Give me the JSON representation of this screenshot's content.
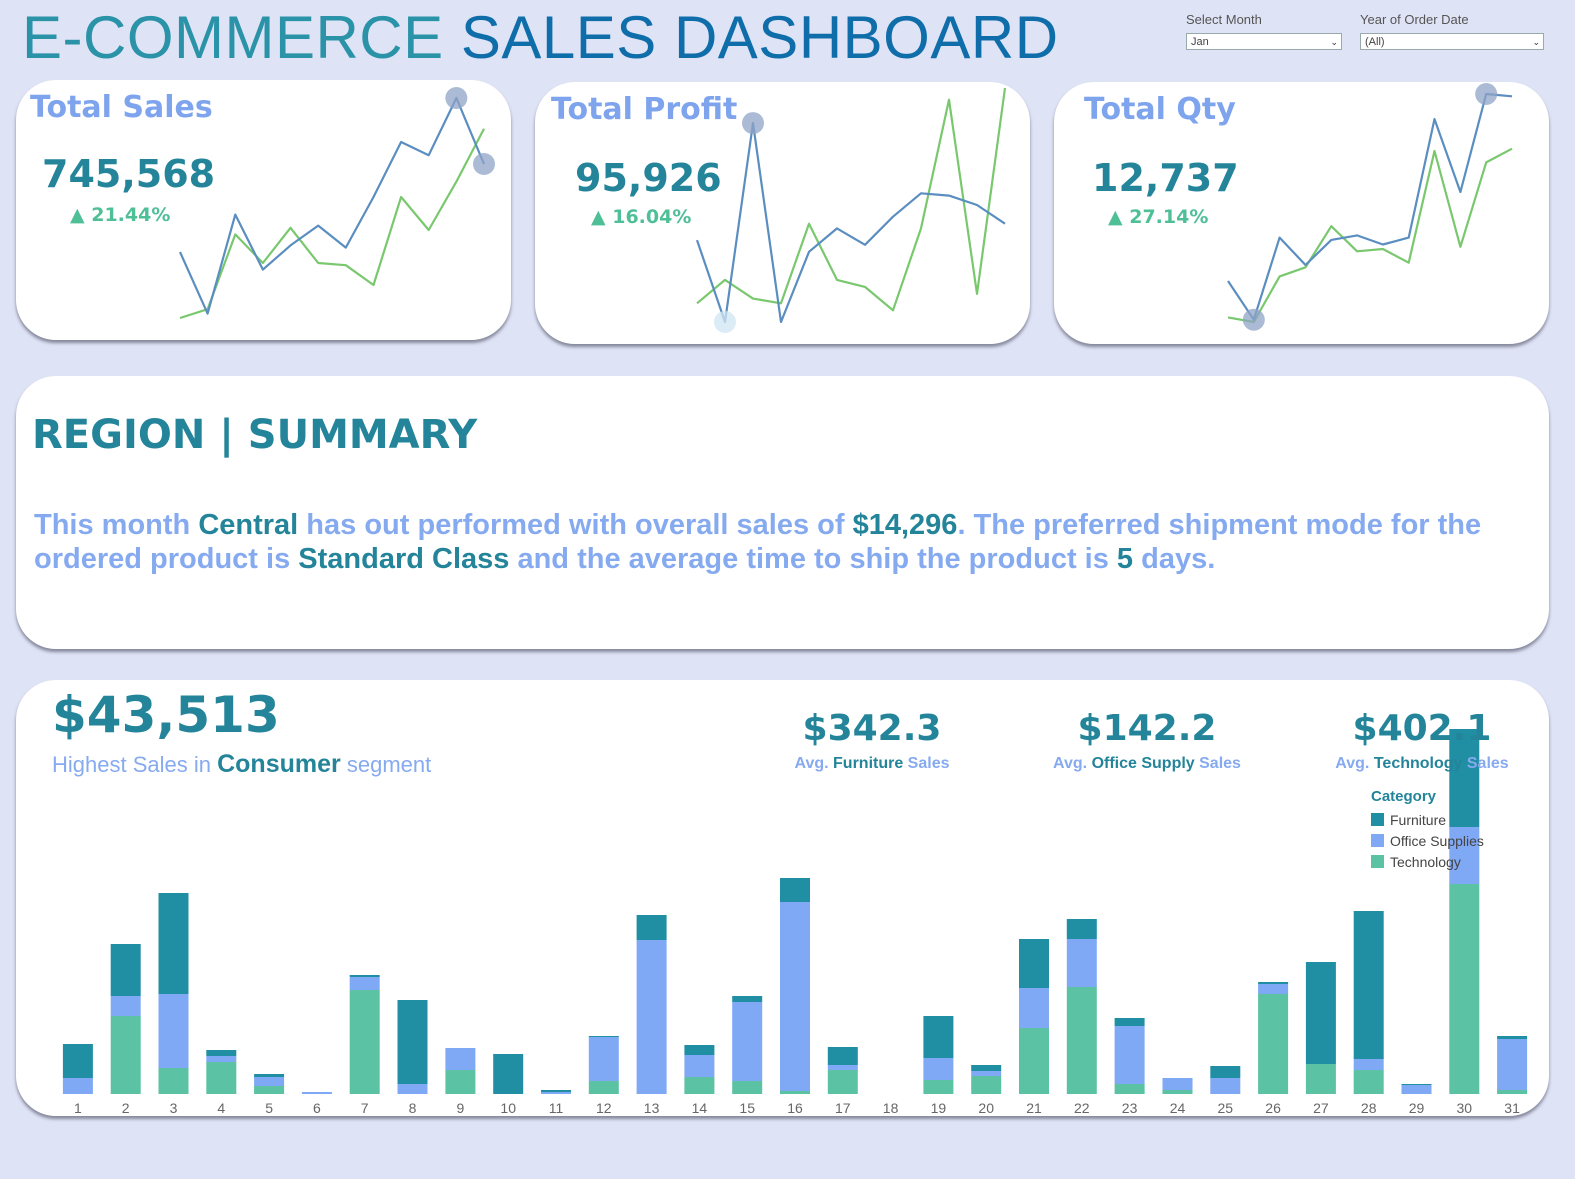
{
  "header": {
    "title_part1": "E-COMMERCE",
    "title_part2": "SALES DASHBOARD"
  },
  "filters": {
    "month": {
      "label": "Select Month",
      "value": "Jan"
    },
    "year": {
      "label": "Year of Order Date",
      "value": "(All)"
    }
  },
  "kpis": [
    {
      "title": "Total Sales",
      "value": "745,568",
      "change": "▲ 21.44%",
      "current": [
        0.3,
        0.02,
        0.47,
        0.22,
        0.33,
        0.42,
        0.32,
        0.55,
        0.8,
        0.74,
        1.0,
        0.7
      ],
      "previous": [
        0.0,
        0.04,
        0.38,
        0.25,
        0.41,
        0.25,
        0.24,
        0.15,
        0.55,
        0.4,
        0.62,
        0.86
      ]
    },
    {
      "title": "Total Profit",
      "value": "95,926",
      "change": "▲ 16.04%",
      "current": [
        0.35,
        0.0,
        0.85,
        0.0,
        0.3,
        0.4,
        0.33,
        0.45,
        0.55,
        0.54,
        0.5,
        0.42
      ],
      "previous": [
        0.08,
        0.18,
        0.1,
        0.08,
        0.42,
        0.18,
        0.15,
        0.05,
        0.4,
        0.95,
        0.12,
        1.0
      ]
    },
    {
      "title": "Total Qty",
      "value": "12,737",
      "change": "▲ 27.14%",
      "current": [
        0.18,
        0.01,
        0.37,
        0.25,
        0.36,
        0.38,
        0.34,
        0.37,
        0.89,
        0.57,
        1.0,
        0.99
      ],
      "previous": [
        0.02,
        0.0,
        0.2,
        0.24,
        0.42,
        0.31,
        0.32,
        0.26,
        0.75,
        0.33,
        0.7,
        0.76
      ]
    }
  ],
  "region": {
    "title": "REGION | SUMMARY",
    "s1": "This month ",
    "region_name": "Central",
    "s2": " has out performed with overall sales of ",
    "sales": "$14,296",
    "s3": ". The preferred shipment mode for the ordered product is ",
    "ship_mode": "Standard Class",
    "s4": " and the average time to ship the product is ",
    "days": "5",
    "s5": " days."
  },
  "segment": {
    "value": "$43,513",
    "sub_before": "Highest Sales in ",
    "segment_name": "Consumer",
    "sub_after": " segment"
  },
  "averages": [
    {
      "value": "$342.3",
      "prefix": "Avg. ",
      "category": "Furniture",
      "suffix": " Sales"
    },
    {
      "value": "$142.2",
      "prefix": "Avg. ",
      "category": "Office Supply",
      "suffix": " Sales"
    },
    {
      "value": "$402.1",
      "prefix": "Avg. ",
      "category": "Technology",
      "suffix": " Sales"
    }
  ],
  "colors": {
    "furniture": "#218fa3",
    "office": "#7fa8f5",
    "technology": "#5bc2a3",
    "spark_current": "#5b8ec0",
    "spark_previous": "#79c86e"
  },
  "chart_data": {
    "type": "bar",
    "stacked": true,
    "categories": [
      "1",
      "2",
      "3",
      "4",
      "5",
      "6",
      "7",
      "8",
      "9",
      "10",
      "11",
      "12",
      "13",
      "14",
      "15",
      "16",
      "17",
      "18",
      "19",
      "20",
      "21",
      "22",
      "23",
      "24",
      "25",
      "26",
      "27",
      "28",
      "29",
      "30",
      "31"
    ],
    "legend_title": "Category",
    "series": [
      {
        "name": "Technology",
        "values": [
          0,
          78,
          26,
          32,
          8,
          0,
          104,
          0,
          24,
          0,
          0,
          13,
          0,
          17,
          13,
          3,
          24,
          0,
          14,
          18,
          66,
          107,
          10,
          4,
          0,
          100,
          30,
          24,
          0,
          210,
          4
        ]
      },
      {
        "name": "Office Supplies",
        "values": [
          16,
          20,
          74,
          6,
          9,
          2,
          13,
          10,
          22,
          0,
          2,
          44,
          154,
          22,
          79,
          189,
          5,
          0,
          22,
          5,
          40,
          48,
          58,
          12,
          16,
          10,
          0,
          11,
          9,
          57,
          51
        ]
      },
      {
        "name": "Furniture",
        "values": [
          34,
          52,
          101,
          6,
          3,
          0,
          2,
          84,
          0,
          40,
          2,
          1,
          25,
          10,
          6,
          24,
          18,
          0,
          42,
          6,
          49,
          20,
          8,
          0,
          12,
          2,
          102,
          148,
          1,
          98,
          3
        ]
      }
    ]
  }
}
